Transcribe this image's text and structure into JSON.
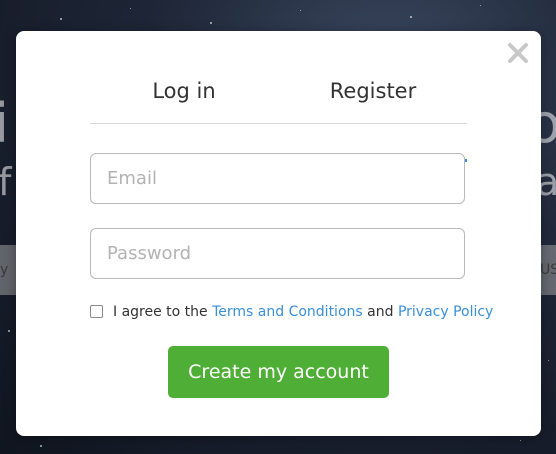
{
  "background": {
    "heading_left": "i",
    "heading_right": "o",
    "subheading_left": "f",
    "subheading_right": "al",
    "bar_left": "y",
    "bar_right": "US"
  },
  "modal": {
    "close_icon": "close-icon",
    "tabs": {
      "login_label": "Log in",
      "register_label": "Register",
      "active": "register"
    },
    "email": {
      "placeholder": "Email",
      "value": ""
    },
    "password": {
      "placeholder": "Password",
      "value": ""
    },
    "agreement": {
      "checked": false,
      "prefix": "I agree to the",
      "terms_link": "Terms and Conditions",
      "conjunction": "and",
      "privacy_link": "Privacy Policy"
    },
    "submit_label": "Create my account"
  },
  "colors": {
    "accent_blue": "#3a8fd8",
    "button_green": "#4fae35",
    "text_dark": "#333333",
    "placeholder_gray": "#b3b3b3"
  }
}
